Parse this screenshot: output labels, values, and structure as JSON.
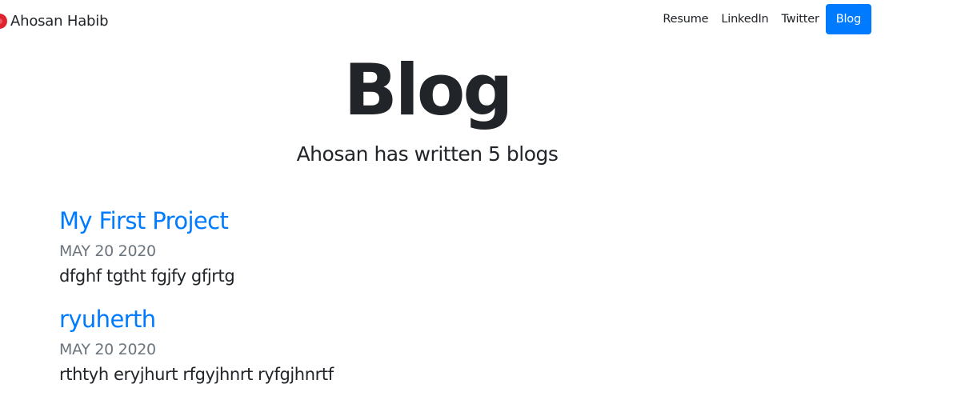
{
  "navbar": {
    "brand_name": "Ahosan Habib",
    "brand_logo_color": "#e0242f",
    "links": [
      {
        "label": "Resume"
      },
      {
        "label": "LinkedIn"
      },
      {
        "label": "Twitter"
      },
      {
        "label": "Blog",
        "active": true,
        "color": "#007bff"
      }
    ]
  },
  "hero": {
    "title": "Blog",
    "subtitle": "Ahosan has written 5 blogs"
  },
  "posts": [
    {
      "title": "My First Project",
      "date": "MAY 20 2020",
      "excerpt": "dfghf tgtht fgjfy gfjrtg"
    },
    {
      "title": "ryuherth",
      "date": "MAY 20 2020",
      "excerpt": "rthtyh eryjhurt rfgyjhnrt ryfgjhnrtf"
    }
  ],
  "colors": {
    "link": "#007bff",
    "muted": "#6c757d",
    "text": "#212529"
  }
}
